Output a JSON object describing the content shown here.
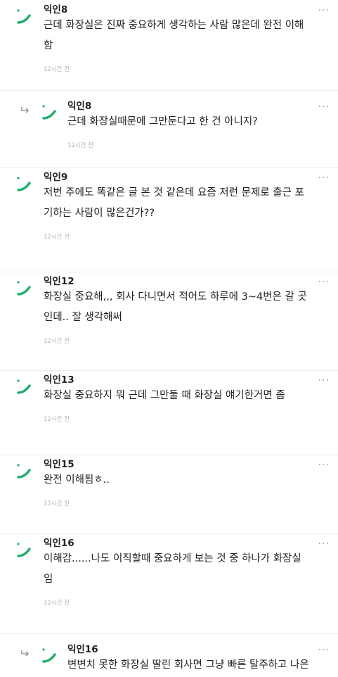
{
  "comments": [
    {
      "nick": "익인8",
      "lines": [
        "근데 화장실은 진짜 중요하게 생각하는 사람 많은데 완전 이해",
        "함"
      ],
      "time": "12시간 전",
      "reply": false,
      "more": "···"
    },
    {
      "nick": "익인8",
      "lines": [
        "근데 화장실때문에 그만둔다고 한 건 아니지?"
      ],
      "time": "12시간 전",
      "reply": true,
      "more": "···"
    },
    {
      "nick": "익인9",
      "lines": [
        "저번 주에도 똑같은 글 본 것 같은데 요즘 저런 문제로 출근 포",
        "기하는 사람이 많은건가??"
      ],
      "time": "12시간 전",
      "reply": false,
      "more": "···"
    },
    {
      "nick": "익인12",
      "lines": [
        "화장실 중요해,,, 회사 다니면서 적어도 하루에 3~4번은 갈 곳",
        "인데.. 잘 생각해써"
      ],
      "time": "12시간 전",
      "reply": false,
      "more": "···"
    },
    {
      "nick": "익인13",
      "lines": [
        "화장실 중요하지 뭐 근데 그만둘 때 화장실 얘기한거면 좀"
      ],
      "time": "12시간 전",
      "reply": false,
      "more": "···"
    },
    {
      "nick": "익인15",
      "lines": [
        "완전 이해됨ㅎ.."
      ],
      "time": "12시간 전",
      "reply": false,
      "more": "···"
    },
    {
      "nick": "익인16",
      "lines": [
        "이해감......나도 이직할때 중요하게 보는 것 중 하나가 화장실",
        "임"
      ],
      "time": "12시간 전",
      "reply": false,
      "more": "···"
    },
    {
      "nick": "익인16",
      "lines": [
        "변변치 못한 화장실 딸린 회사면 그냥 빠른 탈주하고 나은"
      ],
      "time": "",
      "reply": true,
      "more": "···"
    }
  ],
  "colors": {
    "avatar": "#1fae6a",
    "reply_arrow": "#9a9a9a"
  },
  "icons": {
    "avatar": "green-leaf-avatar-icon",
    "reply": "reply-arrow-icon",
    "more": "more-options-icon"
  }
}
